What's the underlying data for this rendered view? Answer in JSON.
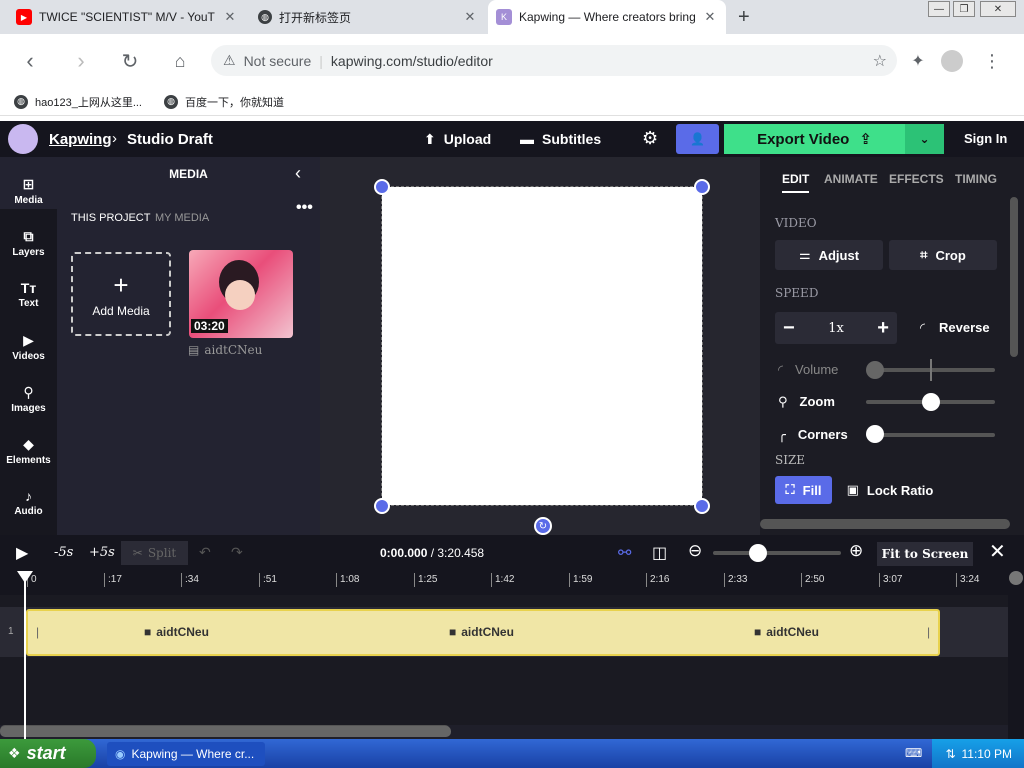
{
  "browser": {
    "tabs": [
      {
        "title": "TWICE \"SCIENTIST\" M/V - YouTube",
        "icon": "youtube-icon"
      },
      {
        "title": "打开新标签页",
        "icon": "globe-icon"
      },
      {
        "title": "Kapwing — Where creators bring sto",
        "icon": "kapwing-icon"
      }
    ],
    "new_tab": "+",
    "security": "Not secure",
    "url": "kapwing.com/studio/editor",
    "bookmarks": [
      {
        "label": "hao123_上网从这里..."
      },
      {
        "label": "百度一下，你就知道"
      }
    ]
  },
  "app": {
    "brand": "Kapwing",
    "crumb_sep": "›",
    "project": "Studio Draft",
    "upload": "Upload",
    "subtitles": "Subtitles",
    "export": "Export Video",
    "signin": "Sign In",
    "rail": [
      {
        "label": "Media",
        "icon": "media-icon",
        "glyph": "⊞"
      },
      {
        "label": "Layers",
        "icon": "layers-icon",
        "glyph": "⧉"
      },
      {
        "label": "Text",
        "icon": "text-icon",
        "glyph": "Tт"
      },
      {
        "label": "Videos",
        "icon": "videos-icon",
        "glyph": "▶"
      },
      {
        "label": "Images",
        "icon": "images-icon",
        "glyph": "⚲"
      },
      {
        "label": "Elements",
        "icon": "elements-icon",
        "glyph": "◆"
      },
      {
        "label": "Audio",
        "icon": "audio-icon",
        "glyph": "♪"
      }
    ],
    "media": {
      "title": "MEDIA",
      "tab_project": "THIS PROJECT",
      "tab_my": "MY MEDIA",
      "add_media": "Add Media",
      "clip_duration": "03:20",
      "clip_name": "aidtCNeu"
    },
    "right": {
      "tabs": [
        "EDIT",
        "ANIMATE",
        "EFFECTS",
        "TIMING"
      ],
      "video_section": "VIDEO",
      "adjust": "Adjust",
      "crop": "Crop",
      "speed_section": "SPEED",
      "speed_value": "1x",
      "reverse": "Reverse",
      "volume": "Volume",
      "zoom": "Zoom",
      "corners": "Corners",
      "size_section": "SIZE",
      "fill": "Fill",
      "lock_ratio": "Lock Ratio"
    },
    "timeline": {
      "minus5": "-5s",
      "plus5": "+5s",
      "split": "Split",
      "time_current": "0:00.000",
      "time_total": "/ 3:20.458",
      "fit": "Fit to Screen",
      "ticks": [
        "0",
        ":17",
        ":34",
        ":51",
        "1:08",
        "1:25",
        "1:42",
        "1:59",
        "2:16",
        "2:33",
        "2:50",
        "3:07",
        "3:24"
      ],
      "track_number": "1",
      "clip_labels": [
        "aidtCNeu",
        "aidtCNeu",
        "aidtCNeu"
      ]
    }
  },
  "taskbar": {
    "start": "start",
    "task": "Kapwing — Where cr...",
    "clock": "11:10 PM"
  }
}
